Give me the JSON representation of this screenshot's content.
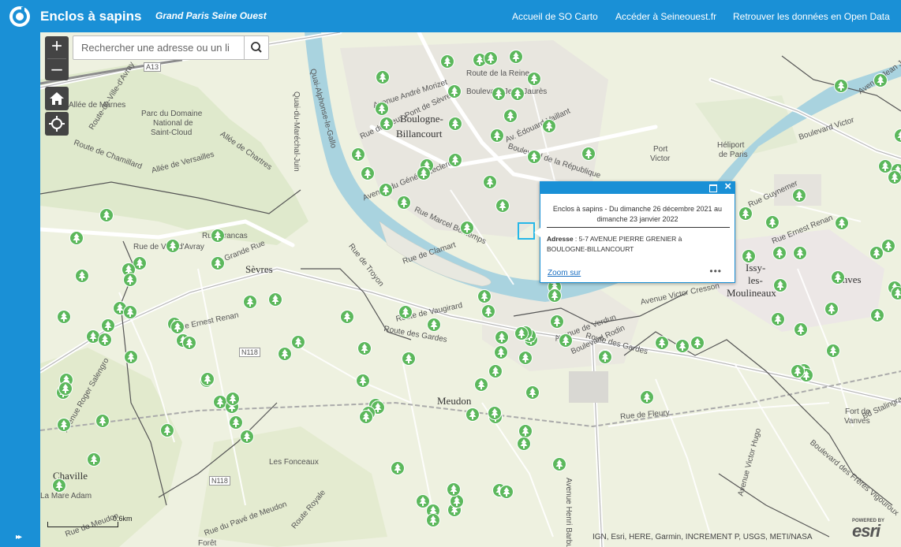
{
  "header": {
    "title": "Enclos à sapins",
    "subtitle": "Grand Paris Seine Ouest",
    "links": [
      {
        "label": "Accueil de SO Carto"
      },
      {
        "label": "Accéder à Seineouest.fr"
      },
      {
        "label": "Retrouver les données en Open Data"
      }
    ]
  },
  "controls": {
    "zoom_in": "+",
    "zoom_out": "–",
    "search_placeholder": "Rechercher une adresse ou un li"
  },
  "popup": {
    "title": "Enclos à sapins - Du dimanche 26 décembre 2021 au dimanche 23 janvier 2022",
    "address_label": "Adresse",
    "address_value": " : 5-7 AVENUE PIERRE GRENIER à BOULOGNE-BILLANCOURT",
    "zoom_link": "Zoom sur",
    "more": "•••"
  },
  "map": {
    "cities": [
      "Boulogne-",
      "Billancourt",
      "Sèvres",
      "Meudon",
      "Issy-",
      "les-",
      "Moulineaux",
      "Vanves",
      "Chaville"
    ],
    "places": [
      "Parc du Domaine",
      "National de",
      "Saint-Cloud",
      "Héliport",
      "de Paris",
      "Port",
      "Victor",
      "Les Fonceaux",
      "La Mare Adam",
      "Fort de",
      "Vanves"
    ],
    "streets": [
      "Route-de-Ville-d'Avray",
      "Allée de Marnes",
      "Route de Chamillard",
      "Allée de Versailles",
      "Allée de Chartres",
      "Quai-Alphonse-le-Gallo",
      "Quai-du-Maréchal-Juin",
      "Route de la Reine",
      "Avenue André Morizet",
      "Boulevard Jean Jaurès",
      "Av. Édouard-Vaillant",
      "Boulevard de la République",
      "Rue du Vieux Pont de Sèvres",
      "Avenue du Général Leclerc",
      "Rue Marcel Bontemps",
      "Rue de Clamart",
      "Grande Rue",
      "Rue Brancas",
      "Rue de Ville-d'Avray",
      "Rue de Troyon",
      "Route de Vaugirard",
      "Route des Gardes",
      "Rue Ernest Renan",
      "Avenue Roger Salengro",
      "Avenue Henri Barbusse",
      "Rue de Meudon",
      "Rue du Pavé de Meudon",
      "Route Royale",
      "Avenue de Verdun",
      "Boulevard Rodin",
      "Avenue Victor Cresson",
      "Boulevard Victor",
      "Avenue Jean Jaurès",
      "Rue Guynemer",
      "Rue Ernest Renan",
      "Rue de Fleury",
      "Bd Stalingrad",
      "Route des Gardes",
      "Avenue Victor Hugo",
      "Boulevard des Frères Vigouroux"
    ],
    "roads": [
      "A13",
      "N118",
      "N118"
    ],
    "partial": [
      "Forêt"
    ]
  },
  "scale": {
    "label": "0.6km"
  },
  "attribution": "IGN, Esri, HERE, Garmin, INCREMENT P, USGS, METI/NASA",
  "esri": {
    "powered_by": "POWERED BY",
    "name": "esri"
  },
  "colors": {
    "header": "#1a90d6",
    "marker": "#5cb85c",
    "water": "#a9d3df",
    "highlight": "#26b7e8"
  }
}
